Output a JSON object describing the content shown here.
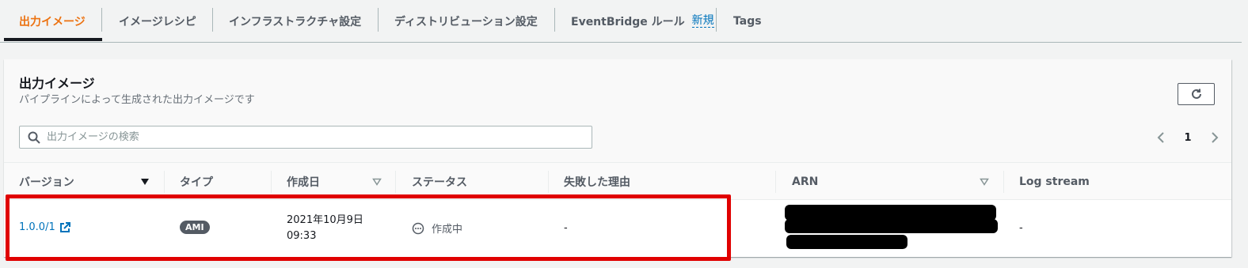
{
  "tabs": [
    {
      "label": "出力イメージ",
      "active": true
    },
    {
      "label": "イメージレシピ"
    },
    {
      "label": "インフラストラクチャ設定"
    },
    {
      "label": "ディストリビューション設定"
    },
    {
      "label": "EventBridge ルール",
      "badge": "新規"
    },
    {
      "label": "Tags"
    }
  ],
  "panel": {
    "title": "出力イメージ",
    "description": "パイプラインによって生成された出力イメージです",
    "refresh_icon": "refresh-icon"
  },
  "search": {
    "placeholder": "出力イメージの検索",
    "value": ""
  },
  "pagination": {
    "current_page": "1"
  },
  "table": {
    "columns": [
      "バージョン",
      "タイプ",
      "作成日",
      "ステータス",
      "失敗した理由",
      "ARN",
      "Log stream"
    ],
    "rows": [
      {
        "version": "1.0.0/1",
        "type": "AMI",
        "created_date": "2021年10月9日",
        "created_time": "09:33",
        "status": "作成中",
        "failure_reason": "-",
        "arn": "",
        "log_stream": "-"
      }
    ]
  },
  "colors": {
    "active_tab": "#ec7211",
    "link": "#0073bb",
    "highlight_border": "#e00000"
  }
}
